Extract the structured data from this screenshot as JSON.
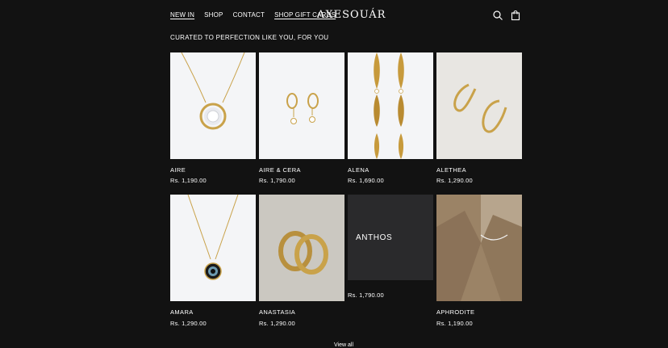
{
  "header": {
    "nav": [
      "NEW IN",
      "SHOP",
      "CONTACT",
      "SHOP GIFT CARDS"
    ],
    "logo": "AXESOUÁR",
    "icons": [
      "search-icon",
      "bag-icon"
    ]
  },
  "section": {
    "subtitle": "CURATED TO PERFECTION LIKE YOU, FOR YOU"
  },
  "products": [
    {
      "name": "AIRE",
      "price": "Rs. 1,190.00"
    },
    {
      "name": "AIRE & CERA",
      "price": "Rs. 1,790.00"
    },
    {
      "name": "ALENA",
      "price": "Rs. 1,690.00"
    },
    {
      "name": "ALETHEA",
      "price": "Rs. 1,290.00"
    },
    {
      "name": "AMARA",
      "price": "Rs. 1,290.00"
    },
    {
      "name": "ANASTASIA",
      "price": "Rs. 1,290.00"
    },
    {
      "name": "ANTHOS",
      "price": "Rs. 1,790.00"
    },
    {
      "name": "APHRODITE",
      "price": "Rs. 1,190.00"
    }
  ],
  "footer": {
    "view_all": "View all"
  }
}
